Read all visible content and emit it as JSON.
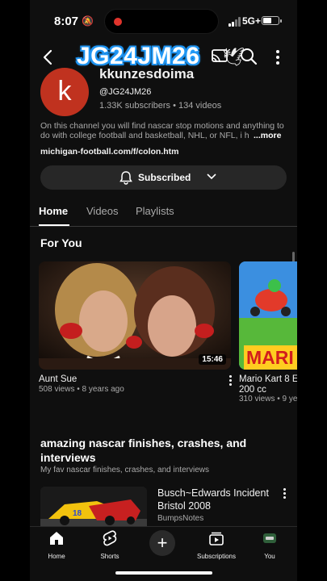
{
  "status_bar": {
    "time": "8:07",
    "network": "5G+"
  },
  "watermark": "JG24JM26",
  "channel": {
    "avatar_letter": "k",
    "name": "kkunzesdoima",
    "handle": "@JG24JM26",
    "meta": "1.33K subscribers  •  134 videos",
    "description": "On this channel you will find nascar stop motions and anything to do with college football and basketball, NHL, or NFL, i h",
    "more_label": "...more",
    "link": "michigan-football.com/f/colon.htm",
    "subscribe_label": "Subscribed"
  },
  "tabs": [
    {
      "label": "Home",
      "active": true
    },
    {
      "label": "Videos",
      "active": false
    },
    {
      "label": "Playlists",
      "active": false
    }
  ],
  "for_you": {
    "title": "For You",
    "videos": [
      {
        "title": "Aunt Sue",
        "meta": "508 views  •  8 years ago",
        "duration": "15:46"
      },
      {
        "title": "Mario Kart 8 E",
        "title2": "200 cc",
        "meta": "310 views  •  9 ye",
        "thumb_text": "MARI"
      }
    ]
  },
  "playlist": {
    "title": "amazing nascar finishes, crashes, and interviews",
    "description": "My fav nascar finishes, crashes, and interviews",
    "video": {
      "title": "Busch~Edwards Incident Bristol 2008",
      "channel": "BumpsNotes"
    }
  },
  "bottom_nav": [
    {
      "label": "Home",
      "icon": "home-icon"
    },
    {
      "label": "Shorts",
      "icon": "shorts-icon"
    },
    {
      "label": "",
      "icon": "create-plus-icon"
    },
    {
      "label": "Subscriptions",
      "icon": "subscriptions-icon"
    },
    {
      "label": "You",
      "icon": "you-avatar-icon"
    }
  ],
  "colors": {
    "background": "#0f0f0f",
    "avatar": "#c0321f",
    "watermark_glow": "#29a3ff",
    "button": "#272727"
  }
}
